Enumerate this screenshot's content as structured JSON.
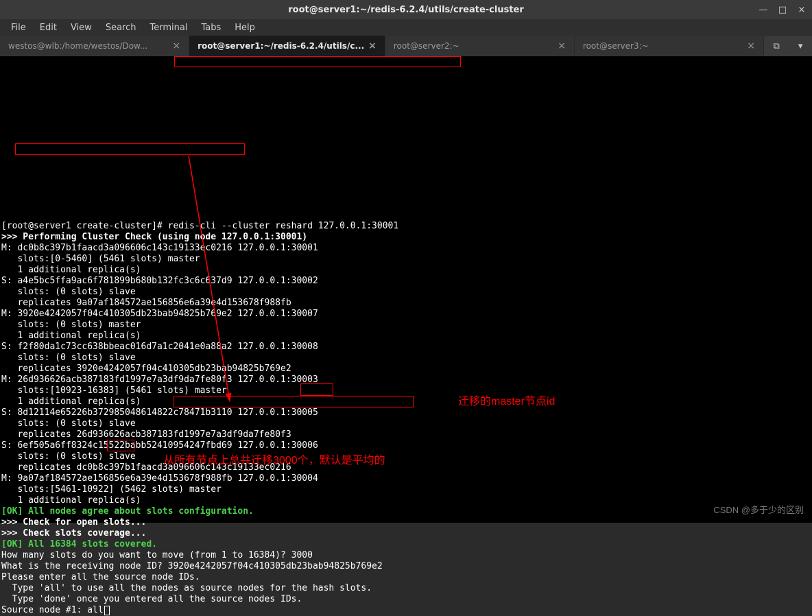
{
  "window": {
    "title": "root@server1:~/redis-6.2.4/utils/create-cluster",
    "minimize": "—",
    "maximize": "□",
    "close": "×"
  },
  "menu": {
    "file": "File",
    "edit": "Edit",
    "view": "View",
    "search": "Search",
    "terminal": "Terminal",
    "tabs": "Tabs",
    "help": "Help"
  },
  "tabs": [
    {
      "label": "westos@wlb:/home/westos/Dow...",
      "active": false
    },
    {
      "label": "root@server1:~/redis-6.2.4/utils/c...",
      "active": true
    },
    {
      "label": "root@server2:~",
      "active": false
    },
    {
      "label": "root@server3:~",
      "active": false
    }
  ],
  "terminal_lines": [
    {
      "segments": [
        {
          "t": "[root@server1 create-cluster]# "
        },
        {
          "t": "redis-cli --cluster reshard 127.0.0.1:30001"
        }
      ]
    },
    {
      "segments": [
        {
          "t": ">>> Performing Cluster Check (using node 127.0.0.1:30001)",
          "cls": "bold"
        }
      ]
    },
    {
      "segments": [
        {
          "t": "M: dc0b8c397b1faacd3a096606c143c19133ec0216 127.0.0.1:30001"
        }
      ]
    },
    {
      "segments": [
        {
          "t": "   slots:[0-5460] (5461 slots) master"
        }
      ]
    },
    {
      "segments": [
        {
          "t": "   1 additional replica(s)"
        }
      ]
    },
    {
      "segments": [
        {
          "t": "S: a4e5bc5ffa9ac6f781899b680b132fc3c6c637d9 127.0.0.1:30002"
        }
      ]
    },
    {
      "segments": [
        {
          "t": "   slots: (0 slots) slave"
        }
      ]
    },
    {
      "segments": [
        {
          "t": "   replicates 9a07af184572ae156856e6a39e4d153678f988fb"
        }
      ]
    },
    {
      "segments": [
        {
          "t": "M: 3920e4242057f04c410305db23bab94825b769e2 127.0.0.1:30007"
        }
      ]
    },
    {
      "segments": [
        {
          "t": "   slots: (0 slots) master"
        }
      ]
    },
    {
      "segments": [
        {
          "t": "   1 additional replica(s)"
        }
      ]
    },
    {
      "segments": [
        {
          "t": "S: f2f80da1c73cc638bbeac016d7a1c2041e0a88a2 127.0.0.1:30008"
        }
      ]
    },
    {
      "segments": [
        {
          "t": "   slots: (0 slots) slave"
        }
      ]
    },
    {
      "segments": [
        {
          "t": "   replicates 3920e4242057f04c410305db23bab94825b769e2"
        }
      ]
    },
    {
      "segments": [
        {
          "t": "M: 26d936626acb387183fd1997e7a3df9da7fe80f3 127.0.0.1:30003"
        }
      ]
    },
    {
      "segments": [
        {
          "t": "   slots:[10923-16383] (5461 slots) master"
        }
      ]
    },
    {
      "segments": [
        {
          "t": "   1 additional replica(s)"
        }
      ]
    },
    {
      "segments": [
        {
          "t": "S: 8d12114e65226b372985048614822c78471b3110 127.0.0.1:30005"
        }
      ]
    },
    {
      "segments": [
        {
          "t": "   slots: (0 slots) slave"
        }
      ]
    },
    {
      "segments": [
        {
          "t": "   replicates 26d936626acb387183fd1997e7a3df9da7fe80f3"
        }
      ]
    },
    {
      "segments": [
        {
          "t": "S: 6ef505a6ff8324c15522babb52410954247fbd69 127.0.0.1:30006"
        }
      ]
    },
    {
      "segments": [
        {
          "t": "   slots: (0 slots) slave"
        }
      ]
    },
    {
      "segments": [
        {
          "t": "   replicates dc0b8c397b1faacd3a096606c143c19133ec0216"
        }
      ]
    },
    {
      "segments": [
        {
          "t": "M: 9a07af184572ae156856e6a39e4d153678f988fb 127.0.0.1:30004"
        }
      ]
    },
    {
      "segments": [
        {
          "t": "   slots:[5461-10922] (5462 slots) master"
        }
      ]
    },
    {
      "segments": [
        {
          "t": "   1 additional replica(s)"
        }
      ]
    },
    {
      "segments": [
        {
          "t": "[OK] All nodes agree about slots configuration.",
          "cls": "green bold"
        }
      ]
    },
    {
      "segments": [
        {
          "t": ">>> Check for open slots...",
          "cls": "bold"
        }
      ]
    },
    {
      "segments": [
        {
          "t": ">>> Check slots coverage...",
          "cls": "bold"
        }
      ]
    },
    {
      "segments": [
        {
          "t": "[OK] All 16384 slots covered.",
          "cls": "green bold"
        }
      ]
    },
    {
      "segments": [
        {
          "t": "How many slots do you want to move (from 1 to 16384)? 3000"
        }
      ]
    },
    {
      "segments": [
        {
          "t": "What is the receiving node ID? 3920e4242057f04c410305db23bab94825b769e2"
        }
      ]
    },
    {
      "segments": [
        {
          "t": "Please enter all the source node IDs."
        }
      ]
    },
    {
      "segments": [
        {
          "t": "  Type 'all' to use all the nodes as source nodes for the hash slots."
        }
      ]
    },
    {
      "segments": [
        {
          "t": "  Type 'done' once you entered all the source nodes IDs."
        }
      ]
    },
    {
      "segments": [
        {
          "t": "Source node #1: all"
        }
      ],
      "cursor": true
    }
  ],
  "annotations": {
    "master_id_label": "迁移的master节点id",
    "migrate_label": "从所有节点上总共迁移3000个，默认是平均的"
  },
  "watermark": "CSDN @多于少的区别"
}
